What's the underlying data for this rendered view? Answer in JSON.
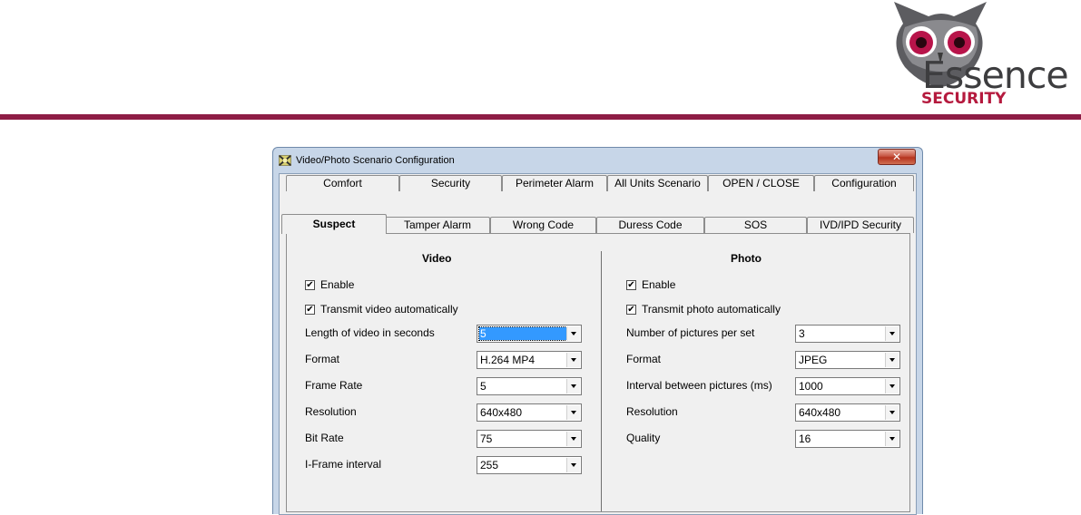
{
  "brand": {
    "name": "Essence",
    "subtitle": "SECURITY",
    "primary": "#8e1d45",
    "accent": "#b51a3e"
  },
  "window": {
    "title": "Video/Photo Scenario Configuration",
    "close": "✕"
  },
  "tabs": {
    "row1": [
      "Comfort",
      "Security",
      "Perimeter Alarm",
      "All Units Scenario",
      "OPEN / CLOSE",
      "Configuration"
    ],
    "row2": [
      "Suspect",
      "Tamper Alarm",
      "Wrong Code",
      "Duress Code",
      "SOS",
      "IVD/IPD Security"
    ],
    "active": "Suspect"
  },
  "video": {
    "heading": "Video",
    "enable": {
      "label": "Enable",
      "checked": true
    },
    "transmit": {
      "label": "Transmit video automatically",
      "checked": true
    },
    "fields": [
      {
        "label": "Length of video in seconds",
        "value": "5",
        "selected": true
      },
      {
        "label": "Format",
        "value": "H.264 MP4"
      },
      {
        "label": "Frame Rate",
        "value": "5"
      },
      {
        "label": "Resolution",
        "value": "640x480"
      },
      {
        "label": "Bit Rate",
        "value": "75"
      },
      {
        "label": "I-Frame interval",
        "value": "255"
      }
    ]
  },
  "photo": {
    "heading": "Photo",
    "enable": {
      "label": "Enable",
      "checked": true
    },
    "transmit": {
      "label": "Transmit photo automatically",
      "checked": true
    },
    "fields": [
      {
        "label": "Number of pictures per set",
        "value": "3"
      },
      {
        "label": "Format",
        "value": "JPEG"
      },
      {
        "label": "Interval between pictures (ms)",
        "value": "1000"
      },
      {
        "label": "Resolution",
        "value": "640x480"
      },
      {
        "label": "Quality",
        "value": "16"
      }
    ]
  }
}
